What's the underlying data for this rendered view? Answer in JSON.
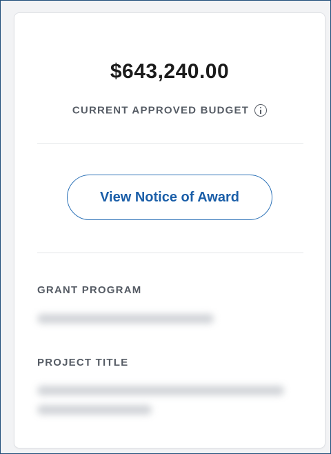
{
  "budget": {
    "amount": "$643,240.00",
    "label": "CURRENT APPROVED BUDGET"
  },
  "actions": {
    "view_notice_label": "View Notice of Award"
  },
  "details": {
    "grant_program_label": "GRANT PROGRAM",
    "project_title_label": "PROJECT TITLE"
  },
  "icons": {
    "info": "info-circle-icon"
  },
  "colors": {
    "button_accent": "#2e73b8",
    "label_gray": "#565c65"
  }
}
